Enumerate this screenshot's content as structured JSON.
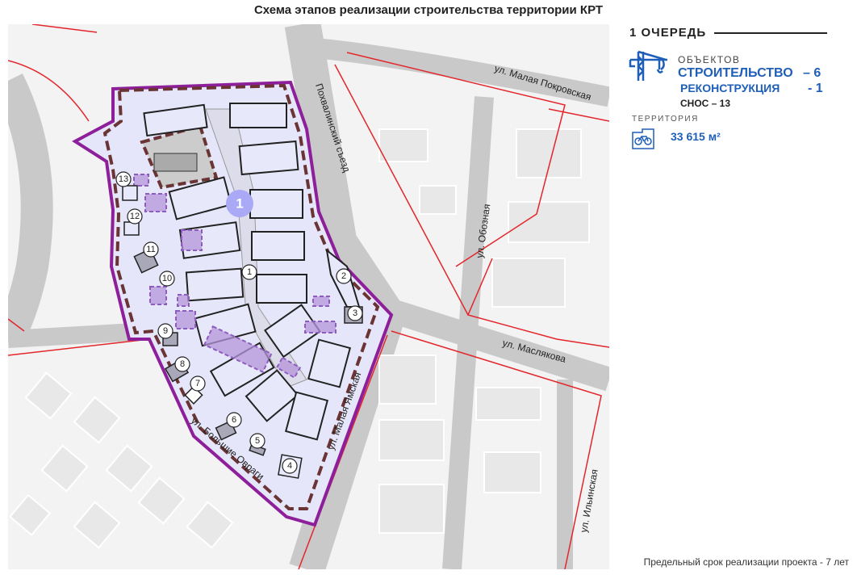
{
  "title": "Схема этапов реализации строительства территории КРТ",
  "legend": {
    "stage": "1 ОЧЕРЕДЬ",
    "objects_label": "ОБЪЕКТОВ",
    "construction_label": "СТРОИТЕЛЬСТВО",
    "construction_value": "– 6",
    "reconstruction_label": "РЕКОНСТРУКЦИЯ",
    "reconstruction_value": "- 1",
    "demolition": "СНОС – 13",
    "territory_label": "ТЕРРИТОРИЯ",
    "territory_value": "33 615 м²",
    "icons": [
      "crane-icon",
      "bicycle-plot-icon"
    ],
    "accent_color": "#1f5fb8"
  },
  "map": {
    "streets": [
      "ул. Малая Покровская",
      "Похвалинский съезд",
      "ул. Обозная",
      "ул. Маслякова",
      "ул. Малая Ямская",
      "ул. Большие Овраги",
      "ул. Ильинская"
    ],
    "stage_marker": "1",
    "object_markers": [
      "1",
      "2",
      "3",
      "4",
      "5",
      "6",
      "7",
      "8",
      "9",
      "10",
      "11",
      "12",
      "13"
    ],
    "colors": {
      "boundary": "#8e1f9a",
      "stage_border": "#6b3434",
      "red_lines": "#e3262b",
      "stage_fill": "#e6e6fa",
      "marker": "#a9a9f5"
    }
  },
  "footer": "Предельный срок реализации проекта - 7 лет"
}
